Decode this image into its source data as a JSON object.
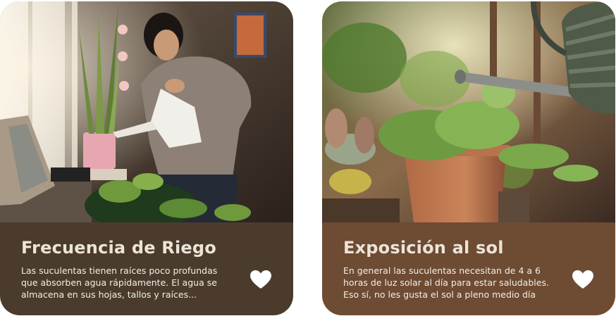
{
  "cards": [
    {
      "title": "Frecuencia de Riego",
      "description": "Las suculentas tienen raíces poco profundas que absorben agua rápidamente. El agua se almacena en sus hojas, tallos y raíces...",
      "image_subject": "woman-watering-plants",
      "favorite_icon": "heart-icon"
    },
    {
      "title": "Exposición al sol",
      "description": "En general las suculentas necesitan de 4 a 6 horas de luz solar al día para estar saludables. Eso sí, no les gusta el sol a pleno medio día",
      "image_subject": "potted-plant-watering-can",
      "favorite_icon": "heart-icon"
    }
  ],
  "colors": {
    "card1_panel": "#4a3b2d",
    "card2_panel": "#6e4b33",
    "title_text": "#ece4d8",
    "body_text": "#f3efe8",
    "heart": "#ffffff"
  }
}
